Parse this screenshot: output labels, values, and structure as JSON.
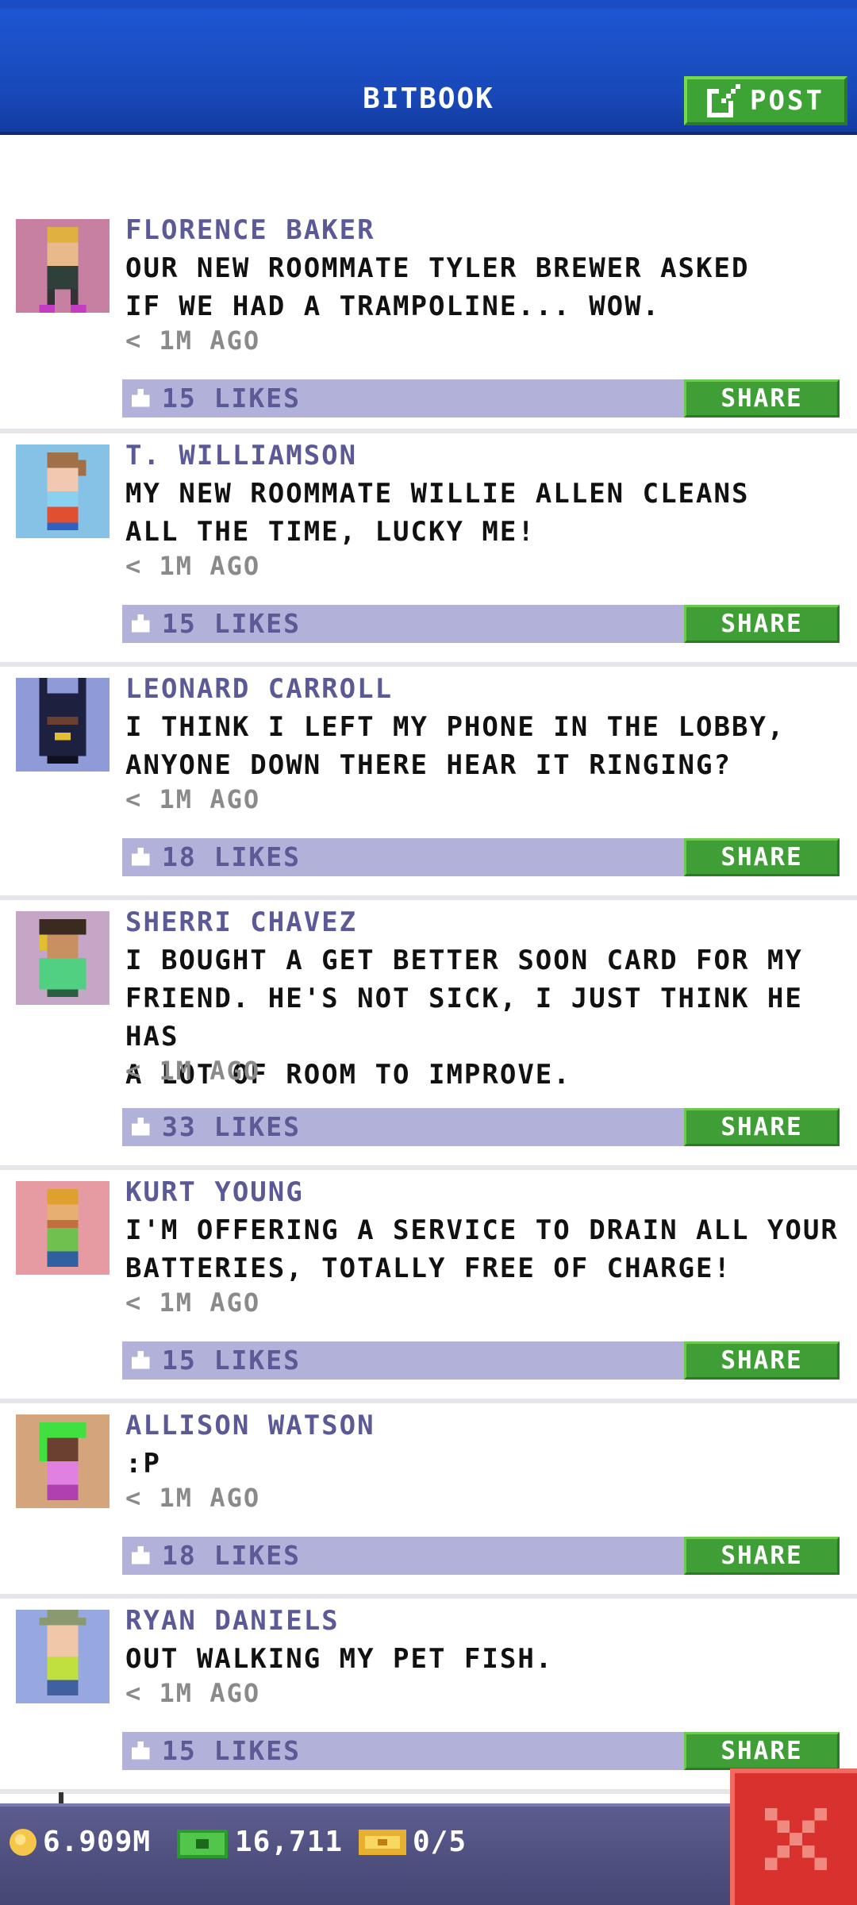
{
  "header": {
    "title": "BITBOOK",
    "post_label": "POST"
  },
  "posts": [
    {
      "name": "FLORENCE BAKER",
      "text": "OUR NEW ROOMMATE TYLER BREWER ASKED\nIF WE HAD A TRAMPOLINE... WOW.",
      "time": "< 1M AGO",
      "likes": "15 LIKES",
      "share": "SHARE",
      "avatar_bg": "#c77fa2"
    },
    {
      "name": "T. WILLIAMSON",
      "text": "MY NEW ROOMMATE WILLIE ALLEN CLEANS\nALL THE TIME, LUCKY ME!",
      "time": "< 1M AGO",
      "likes": "15 LIKES",
      "share": "SHARE",
      "avatar_bg": "#86c1e6"
    },
    {
      "name": "LEONARD CARROLL",
      "text": "I THINK I LEFT MY PHONE IN THE LOBBY,\nANYONE DOWN THERE HEAR IT RINGING?",
      "time": "< 1M AGO",
      "likes": "18 LIKES",
      "share": "SHARE",
      "avatar_bg": "#8f9ad8"
    },
    {
      "name": "SHERRI CHAVEZ",
      "text": "I BOUGHT A GET BETTER SOON CARD FOR MY\nFRIEND. HE'S NOT SICK, I JUST THINK HE HAS\nA LOT OF ROOM TO IMPROVE.",
      "time": "< 1M AGO",
      "likes": "33 LIKES",
      "share": "SHARE",
      "avatar_bg": "#c6a6c6"
    },
    {
      "name": "KURT YOUNG",
      "text": "I'M OFFERING A SERVICE TO DRAIN ALL YOUR\nBATTERIES, TOTALLY FREE OF CHARGE!",
      "time": "< 1M AGO",
      "likes": "15 LIKES",
      "share": "SHARE",
      "avatar_bg": "#e69aa2"
    },
    {
      "name": "ALLISON WATSON",
      "text": ":P",
      "time": "< 1M AGO",
      "likes": "18 LIKES",
      "share": "SHARE",
      "avatar_bg": "#d4a47c"
    },
    {
      "name": "RYAN DANIELS",
      "text": "OUT WALKING MY PET FISH.",
      "time": "< 1M AGO",
      "likes": "15 LIKES",
      "share": "SHARE",
      "avatar_bg": "#97a8e0"
    }
  ],
  "bottom_bar": {
    "coins": "6.909M",
    "bux": "16,711",
    "tickets": "0/5"
  }
}
